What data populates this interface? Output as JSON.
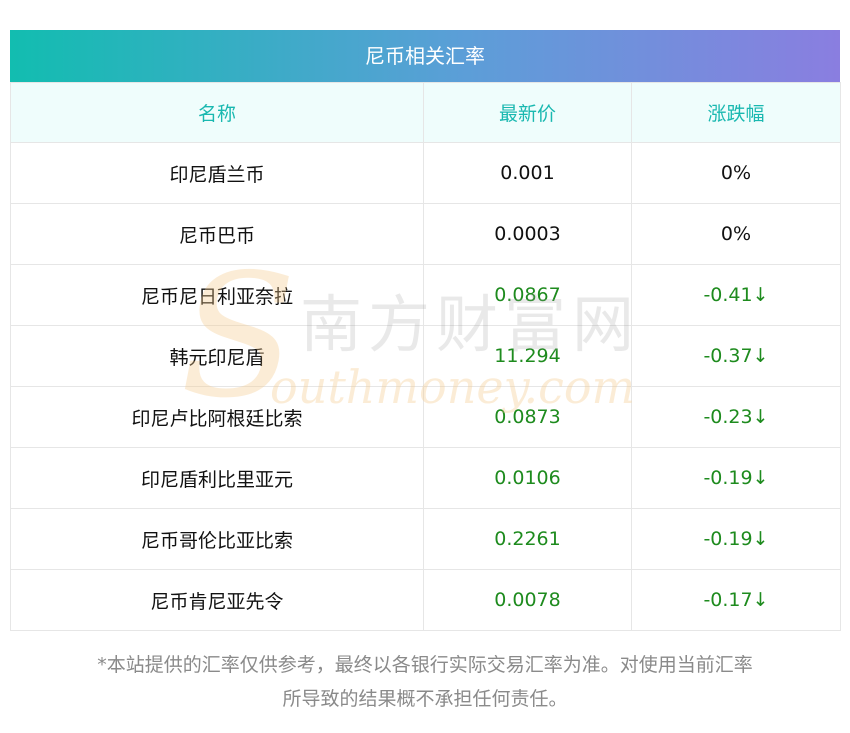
{
  "title": "尼币相关汇率",
  "headers": [
    "名称",
    "最新价",
    "涨跌幅"
  ],
  "rows": [
    {
      "name": "印尼盾兰币",
      "price": "0.001",
      "change": "0%",
      "trend": "flat"
    },
    {
      "name": "尼币巴币",
      "price": "0.0003",
      "change": "0%",
      "trend": "flat"
    },
    {
      "name": "尼币尼日利亚奈拉",
      "price": "0.0867",
      "change": "-0.41↓",
      "trend": "down"
    },
    {
      "name": "韩元印尼盾",
      "price": "11.294",
      "change": "-0.37↓",
      "trend": "down"
    },
    {
      "name": "印尼卢比阿根廷比索",
      "price": "0.0873",
      "change": "-0.23↓",
      "trend": "down"
    },
    {
      "name": "印尼盾利比里亚元",
      "price": "0.0106",
      "change": "-0.19↓",
      "trend": "down"
    },
    {
      "name": "尼币哥伦比亚比索",
      "price": "0.2261",
      "change": "-0.19↓",
      "trend": "down"
    },
    {
      "name": "尼币肯尼亚先令",
      "price": "0.0078",
      "change": "-0.17↓",
      "trend": "down"
    }
  ],
  "watermark": {
    "cn": "南方财富网",
    "en": "outhmoney.com"
  },
  "footnote": {
    "line1": "*本站提供的汇率仅供参考，最终以各银行实际交易汇率为准。对使用当前汇率",
    "line2": "所导致的结果概不承担任何责任。"
  },
  "colors": {
    "header_text": "#19b8b0",
    "down": "#1e8b1e",
    "gradient_start": "#12bdb0",
    "gradient_end": "#8a7ee0"
  }
}
